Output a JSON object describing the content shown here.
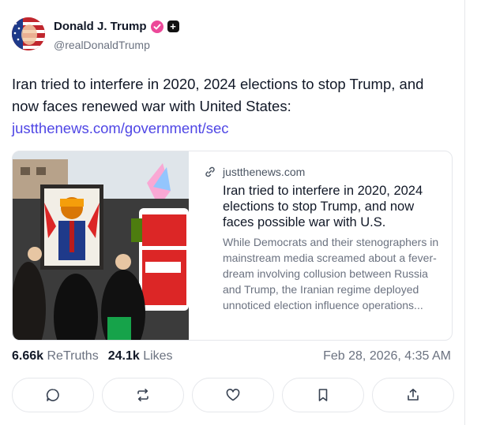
{
  "author": {
    "name": "Donald J. Trump",
    "handle": "@realDonaldTrump",
    "verified_color": "#ec4899",
    "plus_badge": "+"
  },
  "post": {
    "text": "Iran tried to interfere in 2020, 2024 elections to stop Trump, and now faces renewed war with United States:",
    "link_text": "justthenews.com/government/sec",
    "link_color": "#4f46e5"
  },
  "preview": {
    "domain": "justthenews.com",
    "title": "Iran tried to interfere in 2020, 2024 elections to stop Trump, and now faces possible war with U.S.",
    "description": "While Democrats and their stenographers in mainstream media screamed about a fever-dream involving collusion between Russia and Trump, the Iranian regime deployed unnoticed election influence operations..."
  },
  "stats": {
    "retruths_count": "6.66k",
    "retruths_label": "ReTruths",
    "likes_count": "24.1k",
    "likes_label": "Likes",
    "timestamp": "Feb 28, 2026, 4:35 AM"
  },
  "actions": [
    {
      "name": "reply",
      "icon": "chat-bubble-icon"
    },
    {
      "name": "retruth",
      "icon": "repost-icon"
    },
    {
      "name": "like",
      "icon": "heart-icon"
    },
    {
      "name": "bookmark",
      "icon": "bookmark-icon"
    },
    {
      "name": "share",
      "icon": "share-icon"
    }
  ]
}
